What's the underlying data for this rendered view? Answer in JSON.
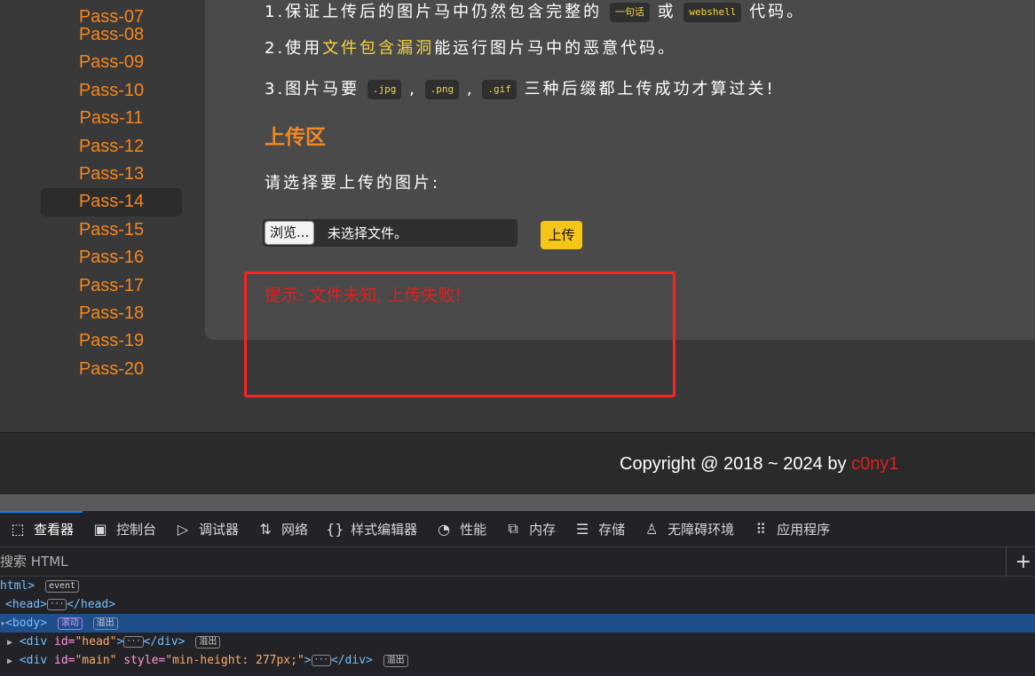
{
  "nav": {
    "items": [
      "Pass-07",
      "Pass-08",
      "Pass-09",
      "Pass-10",
      "Pass-11",
      "Pass-12",
      "Pass-13",
      "Pass-14",
      "Pass-15",
      "Pass-16",
      "Pass-17",
      "Pass-18",
      "Pass-19",
      "Pass-20"
    ],
    "active": "Pass-14"
  },
  "rules": {
    "r1_prefix": "1.保证上传后的图片马中仍然包含完整的",
    "r1_code1": "一句话",
    "r1_mid": "或",
    "r1_code2": "webshell",
    "r1_suffix": "代码。",
    "r2_prefix": "2.使用",
    "r2_highlight": "文件包含漏洞",
    "r2_suffix": "能运行图片马中的恶意代码。",
    "r3_prefix": "3.图片马要",
    "r3_code1": ".jpg",
    "r3_sep1": ",",
    "r3_code2": ".png",
    "r3_sep2": ",",
    "r3_code3": ".gif",
    "r3_suffix": "三种后缀都上传成功才算过关!"
  },
  "upload": {
    "heading": "上传区",
    "prompt": "请选择要上传的图片:",
    "browse_label": "浏览...",
    "file_status": "未选择文件。",
    "submit_label": "上传"
  },
  "hint": "提示: 文件未知, 上传失败!",
  "footer": {
    "copyright_prefix": "Copyright @ 2018 ~ 2024 by ",
    "author": "c0ny1"
  },
  "devtools": {
    "tabs": [
      {
        "label": "查看器",
        "icon": "inspector-icon"
      },
      {
        "label": "控制台",
        "icon": "console-icon"
      },
      {
        "label": "调试器",
        "icon": "debugger-icon"
      },
      {
        "label": "网络",
        "icon": "network-icon"
      },
      {
        "label": "样式编辑器",
        "icon": "style-editor-icon"
      },
      {
        "label": "性能",
        "icon": "performance-icon"
      },
      {
        "label": "内存",
        "icon": "memory-icon"
      },
      {
        "label": "存储",
        "icon": "storage-icon"
      },
      {
        "label": "无障碍环境",
        "icon": "accessibility-icon"
      },
      {
        "label": "应用程序",
        "icon": "application-icon"
      }
    ],
    "search_placeholder": "搜索 HTML",
    "tree": {
      "html_tag": "html>",
      "event_badge": "event",
      "head_open": "<head>",
      "head_close": "</head>",
      "body_tag": "<body>",
      "body_badge1": "滚动",
      "body_badge2": "溢出",
      "div_head_tag": "<div",
      "div_head_attr": "id=",
      "div_head_val": "\"head\"",
      "div_close": "</div>",
      "div_head_badge": "溢出",
      "div_main_tag": "<div",
      "div_main_attr1": "id=",
      "div_main_val1": "\"main\"",
      "div_main_attr2": "style=",
      "div_main_val2": "\"min-height: 277px;\"",
      "div_main_badge": "溢出"
    }
  }
}
